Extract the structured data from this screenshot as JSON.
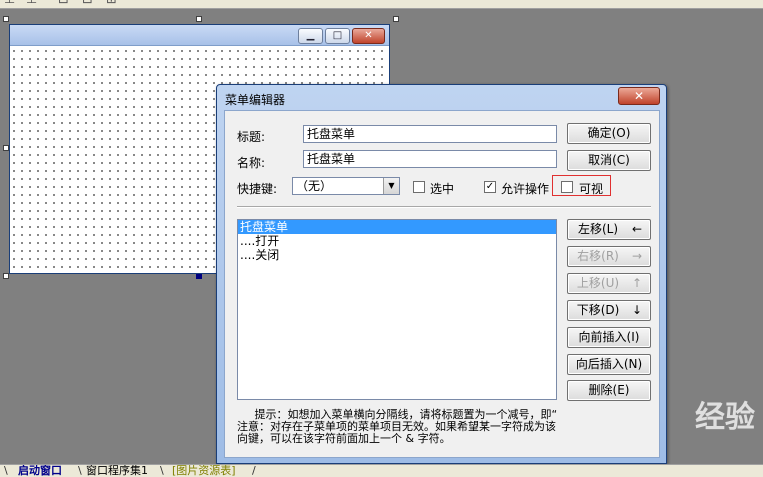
{
  "toolbar": {
    "icons": [
      "align-top-icon",
      "align-bottom-icon",
      "size-icon",
      "down-icon",
      "grid-icon"
    ]
  },
  "design_form": {
    "buttons": {
      "minimize": "▁",
      "maximize": "□",
      "close": "✕"
    }
  },
  "dialog": {
    "title": "菜单编辑器",
    "close": "✕",
    "title_label": "标题:",
    "title_value": "托盘菜单",
    "name_label": "名称:",
    "name_value": "托盘菜单",
    "shortcut_label": "快捷键:",
    "shortcut_value": "（无）",
    "checked_label": "选中",
    "checked": false,
    "allow_label": "允许操作",
    "allow": true,
    "visible_label": "可视",
    "visible": false,
    "ok_button": "确定(O)",
    "cancel_button": "取消(C)",
    "left_button": "左移(L)",
    "right_button": "右移(R)",
    "up_button": "上移(U)",
    "down_button": "下移(D)",
    "insert_before_button": "向前插入(I)",
    "insert_after_button": "向后插入(N)",
    "delete_button": "删除(E)",
    "arrows": {
      "left": "←",
      "right": "→",
      "up": "↑",
      "down": "↓"
    },
    "menu_items": [
      "托盘菜单",
      "....打开",
      "....关闭"
    ],
    "selected_index": 0,
    "hint_line1": "     提示：如想加入菜单横向分隔线，请将标题置为一个减号，即“",
    "hint_line2": "注意：对存在子菜单项的菜单项目无效。如果希望某一字符成为该",
    "hint_line3": "向键，可以在该字符前面加上一个 & 字符。"
  },
  "tabs": [
    {
      "label": "启动窗口",
      "state": "active"
    },
    {
      "label": "窗口程序集1",
      "state": "normal"
    },
    {
      "label": "[图片资源表]",
      "state": "resource"
    }
  ],
  "watermark": "经验"
}
